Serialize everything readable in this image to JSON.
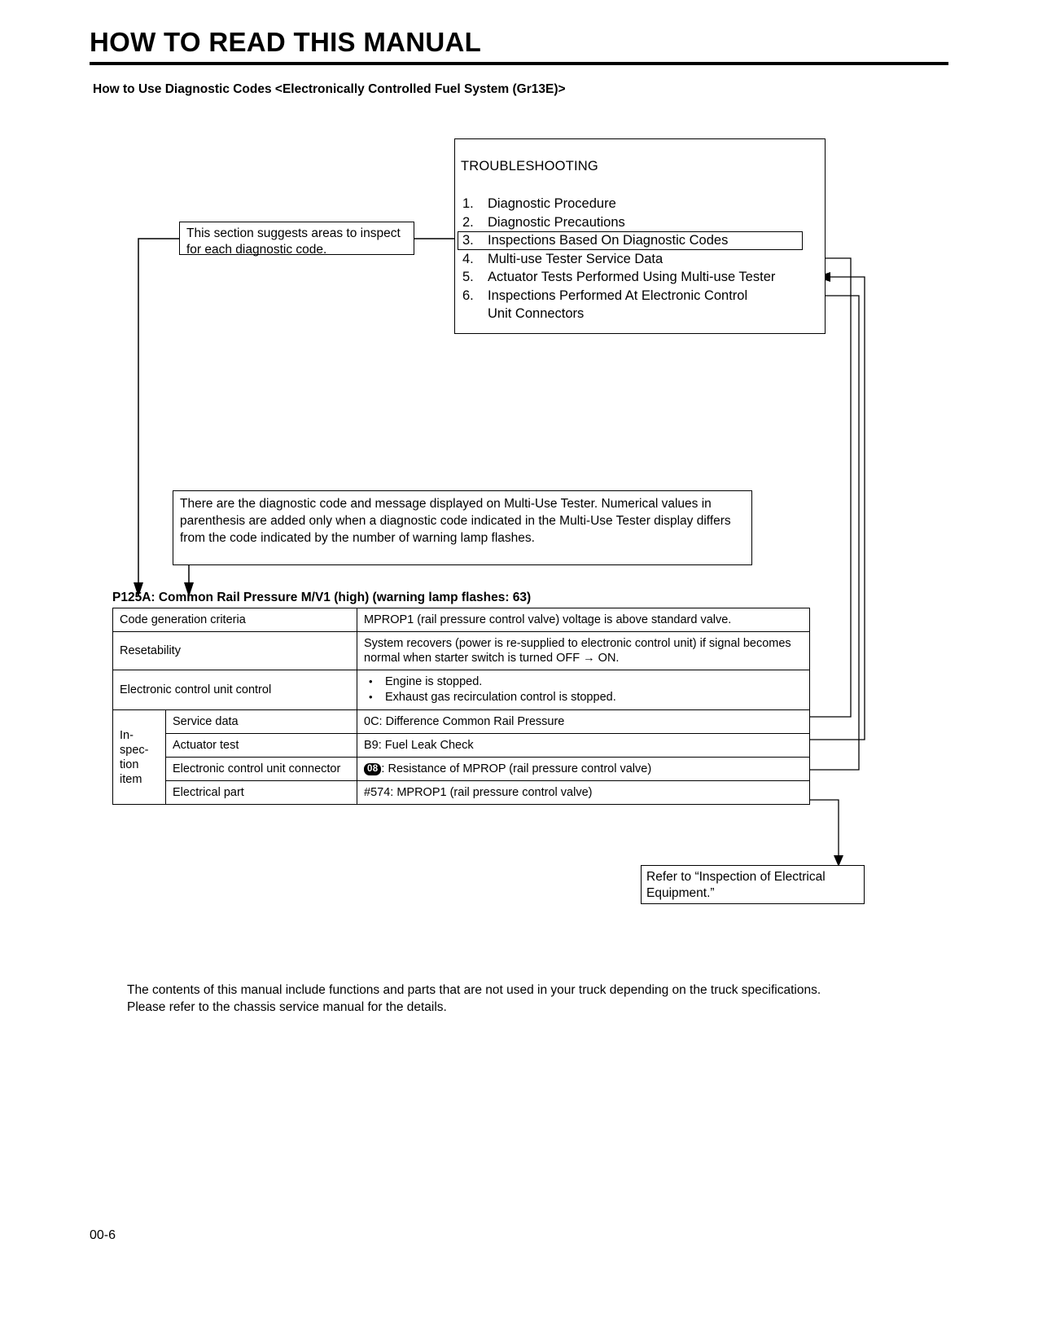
{
  "header": {
    "title": "HOW TO READ THIS MANUAL",
    "subtitle": "How to Use Diagnostic Codes <Electronically Controlled Fuel System (Gr13E)>"
  },
  "troubleshooting_box": {
    "heading": "TROUBLESHOOTING",
    "items": [
      {
        "num": "1.",
        "label": "Diagnostic Procedure"
      },
      {
        "num": "2.",
        "label": "Diagnostic Precautions"
      },
      {
        "num": "3.",
        "label": "Inspections Based On Diagnostic Codes"
      },
      {
        "num": "4.",
        "label": "Multi-use Tester Service Data"
      },
      {
        "num": "5.",
        "label": "Actuator Tests Performed Using Multi-use Tester"
      },
      {
        "num": "6.",
        "label": "Inspections Performed At Electronic Control",
        "label2": "Unit Connectors"
      }
    ]
  },
  "callouts": {
    "section_suggests": "This section suggests areas to inspect for each diagnostic code.",
    "diagnostic_note": "There are the diagnostic code and message displayed on Multi-Use Tester. Numerical values in parenthesis are added only when a diagnostic code indicated in the Multi-Use Tester display differs from the code indicated by the number of warning lamp flashes.",
    "refer_box": "Refer to “Inspection of Electrical Equipment.”"
  },
  "table": {
    "heading": "P125A: Common Rail Pressure M/V1 (high) (warning lamp flashes: 63)",
    "rows": {
      "code_generation_criteria_label": "Code generation criteria",
      "code_generation_criteria_value": "MPROP1 (rail pressure control valve) voltage is above standard valve.",
      "resetability_label": "Resetability",
      "resetability_value": "System recovers (power is re-supplied to electronic control unit) if signal becomes normal when starter switch is turned OFF → ON.",
      "ecu_control_label": "Electronic control unit control",
      "ecu_control_bullets": [
        "Engine is stopped.",
        "Exhaust gas recirculation control is stopped."
      ],
      "inspection_item_label": "In-\nspec-\ntion\nitem",
      "service_data_label": "Service data",
      "service_data_value": "0C: Difference Common Rail Pressure",
      "actuator_test_label": "Actuator test",
      "actuator_test_value": "B9: Fuel Leak Check",
      "ecu_connector_label": "Electronic control unit connector",
      "ecu_connector_badge": "08",
      "ecu_connector_value": ": Resistance of MPROP (rail pressure control valve)",
      "electrical_part_label": "Electrical part",
      "electrical_part_value": "#574: MPROP1 (rail pressure control valve)"
    }
  },
  "footer": {
    "note": "The contents of this manual include functions and parts that are not used in your truck depending on the truck specifications. Please refer to the chassis service manual for the details.",
    "page_number": "00-6"
  }
}
